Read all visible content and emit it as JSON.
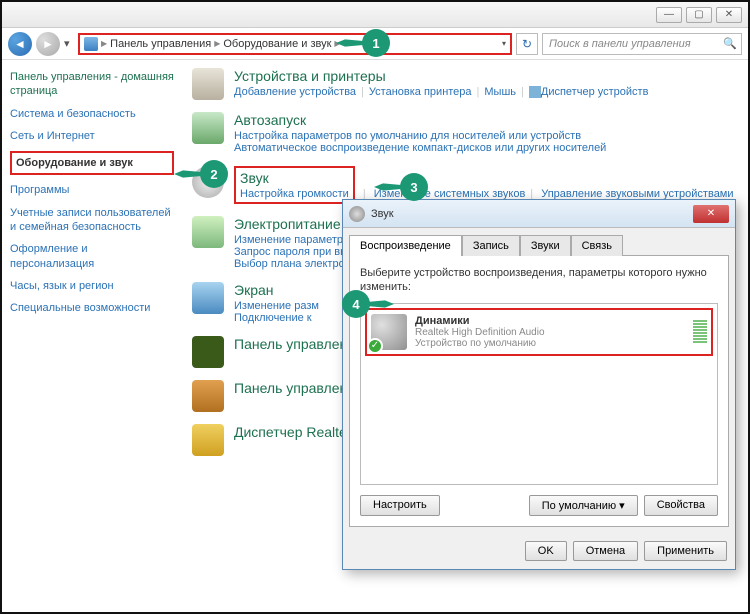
{
  "window": {
    "min": "—",
    "max": "▢",
    "close": "✕"
  },
  "breadcrumb": {
    "control_panel": "Панель управления",
    "hw_sound": "Оборудование и звук"
  },
  "search": {
    "placeholder": "Поиск в панели управления"
  },
  "callouts": {
    "c1": "1",
    "c2": "2",
    "c3": "3",
    "c4": "4"
  },
  "sidebar": {
    "home": "Панель управления - домашняя страница",
    "items": [
      "Система и безопасность",
      "Сеть и Интернет",
      "Оборудование и звук",
      "Программы",
      "Учетные записи пользователей и семейная безопасность",
      "Оформление и персонализация",
      "Часы, язык и регион",
      "Специальные возможности"
    ]
  },
  "categories": {
    "devices": {
      "title": "Устройства и принтеры",
      "links": [
        "Добавление устройства",
        "Установка принтера",
        "Мышь",
        "Диспетчер устройств"
      ]
    },
    "autoplay": {
      "title": "Автозапуск",
      "links": [
        "Настройка параметров по умолчанию для носителей или устройств",
        "Автоматическое воспроизведение компакт-дисков или других носителей"
      ]
    },
    "sound": {
      "title": "Звук",
      "links": [
        "Настройка громкости",
        "Изменение системных звуков",
        "Управление звуковыми устройствами"
      ]
    },
    "power": {
      "title": "Электропитание",
      "links": [
        "Изменение параметро",
        "Запрос пароля при вы",
        "Выбор плана электроп"
      ]
    },
    "display": {
      "title": "Экран",
      "links": [
        "Изменение разм",
        "Подключение к"
      ]
    },
    "nvidia": {
      "title": "Панель управления"
    },
    "realtek_panel": {
      "title": "Панель управления"
    },
    "realtek": {
      "title": "Диспетчер Realtek"
    }
  },
  "dialog": {
    "title": "Звук",
    "tabs": [
      "Воспроизведение",
      "Запись",
      "Звуки",
      "Связь"
    ],
    "instruction": "Выберите устройство воспроизведения, параметры которого нужно изменить:",
    "device": {
      "name": "Динамики",
      "driver": "Realtek High Definition Audio",
      "status": "Устройство по умолчанию"
    },
    "buttons": {
      "configure": "Настроить",
      "default": "По умолчанию",
      "properties": "Свойства",
      "ok": "OK",
      "cancel": "Отмена",
      "apply": "Применить"
    }
  }
}
